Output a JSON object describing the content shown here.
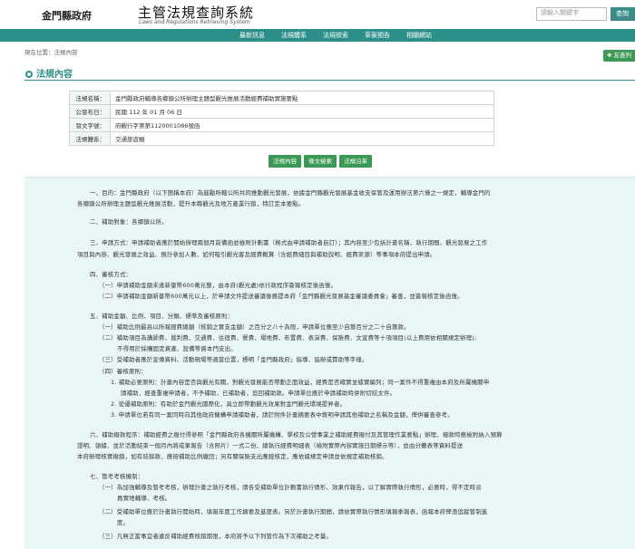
{
  "header": {
    "county": "金門縣政府",
    "system_title": "主管法規查詢系統",
    "system_subtitle": "Laws and Regulations Retrieving System",
    "search_placeholder": "請輸入關鍵字",
    "search_label": "查詢"
  },
  "nav": [
    "最新訊息",
    "法規體系",
    "法規檢索",
    "草案預告",
    "相關網站"
  ],
  "breadcrumb": "現在位置：法規內容",
  "share_label": "友善列",
  "section_title": "法規內容",
  "meta": [
    {
      "key": "法規名稱：",
      "value": "金門縣政府輔導各鄉鎮公所辦理主題型觀光推展活動經費補助實施要點"
    },
    {
      "key": "公發布日：",
      "value": "民國 112 年 01 月 06 日"
    },
    {
      "key": "發文字號：",
      "value": "府觀行字第第1120001086號函"
    },
    {
      "key": "法規體系：",
      "value": "交通旅遊類"
    }
  ],
  "buttons": [
    "法規內容",
    "條文檢索",
    "法規沿革"
  ],
  "content_lines": [
    "一、目的：金門縣政府（以下簡稱本府）為鼓勵所轄公所共同推動觀光發展，依據金門縣觀光發展基金收支保管及運用辦法第六條之一規定，輔導金門的",
    "各鄉鎮公所辦理主題型觀光推展活動，提升本縣觀光及地方產業行銷，特訂定本要點。",
    "二、補助對象：各鄉鎮公所。",
    "三、申請方式：申請補助者應於開始辦理兩個月前備函並檢附計劃書（格式由申請補助者自訂）；其內容至少包括計畫名稱、執行期間、觀光發展之工作",
    "項目與內容、觀光發展之效益、預計參加人數、如何吸引觀光客及經費概算（含經費細目與補助說明、經費來源）等事項本府提出申請。",
    "四、審核方式：",
    "（一）申請補助金額未達新臺幣600萬元整，由本府(觀光處)依行政程序簽報核定後函復。",
    "（二）申請補助金額新臺幣600萬元以上，於申請文件提送審議後應提本府「金門縣觀光發展基金審議委員會」審查，並簽報核定後函復。",
    "五、補助金額、比例、項目、分類、標準及審核原則：",
    "（一）補助比例最高以所報經費總額（核銷之實支金額）之百分之八十為限，申請單位應至少自籌百分之二十自籌款。",
    "（二）補助項目為講師費、裁判費、交通費、住宿費、餐費、場地費、布置費、表演費、保險費、文宣費等十項項目(以上費用依相關規定辦理);",
    "不得用於採購固定資產、設備等資本門支出。",
    "（三）受補助者應於宣傳資料、活動現場等適當位置，標明「金門縣政府」指導、協辦或贊助等字樣。",
    "（四）審核原則：",
    "1. 補助必要原則：計畫內容是否與觀光有關，對觀光發展能否帶動正面效益，經費是否確實並據實編列；同一案件不得重複由本府及所屬機關申",
    "請補助，經查重複申請者，不予補助，已補助者，追回補助款。申請單位應於申請補助時併附切結文件。",
    "2. 從優補助原則：有助於金門觀光國際化，具立即帶動觀光效果對金門觀光環境提昇者。",
    "3. 申請單位若有同一案同時向其他政府機構申請補助者，請於附件計畫摘要表中敘明申請其他補助之名稱及金額，俾供審查參考。",
    "六、補助撥款程序：補助經費之撥付得參照「金門縣政府各機關所屬機構、學校及公營事業之補助經費撥付及其管理作業要點」辦理，撥款時應檢附納入預算",
    "證明、領據、並於活動結束一個月內將成果報告（含照片）一式二份、總執行經費明細表（檢附實際內容實施日期標示等），並由分攤表等資料提送",
    "本府辦理核實撥銷，如有結餘款，應按補助比例繳回；另有關保險支出應經核定，應依據規定申請並依規定補助核銷。",
    "七、管考考核機制：",
    "（一）為加強輔導及管考考核，辦理計畫之執行考核，請各受補助單位計劃書執行情形、效果作報告，以了解實際執行情形，必要時，得不定時派",
    "員實地輔導、考核。",
    "（二）受補助單位應於計畫執行開始時，填報年度工作摘要及進度表。另於計畫執行期間，請依實際執行情形填報季報表，函報本府俾憑追蹤管制進",
    "度。",
    "（三）凡無正當事宜者違反補助經費核銷期限，本府將予以下列管作為下次補助之考量。"
  ]
}
